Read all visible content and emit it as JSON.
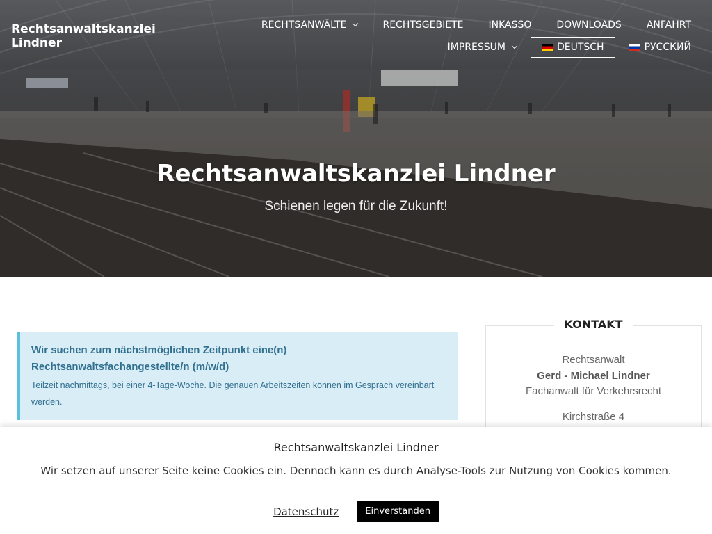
{
  "site": {
    "title": "Rechtsanwaltskanzlei Lindner"
  },
  "nav": {
    "items": [
      {
        "label": "Rechtsanwälte",
        "has_dropdown": true
      },
      {
        "label": "Rechtsgebiete"
      },
      {
        "label": "Inkasso"
      },
      {
        "label": "Downloads"
      },
      {
        "label": "Anfahrt"
      },
      {
        "label": "Impressum",
        "has_dropdown": true
      },
      {
        "label": "Deutsch",
        "flag": "flag-germany-icon",
        "active": true
      },
      {
        "label": "Русский",
        "flag": "flag-russia-icon"
      }
    ]
  },
  "hero": {
    "title": "Rechtsanwaltskanzlei Lindner",
    "subtitle": "Schienen legen für die Zukunft!"
  },
  "notice": {
    "title": "Wir suchen zum nächstmöglichen Zeitpunkt eine(n) Rechtsanwaltsfachangestellte/n (m/w/d)",
    "text": "Teilzeit nachmittags, bei einer 4-Tage-Woche. Die genauen Arbeitszeiten können im Gespräch vereinbart werden."
  },
  "sidebar": {
    "title": "KONTAKT",
    "role": "Rechtsanwalt",
    "name": "Gerd - Michael Lindner",
    "specialty": "Fachanwalt für Verkehrsrecht",
    "street": "Kirchstraße 4"
  },
  "cookie": {
    "title": "Rechtsanwaltskanzlei Lindner",
    "text": "Wir setzen auf unserer Seite keine Cookies ein. Dennoch kann es durch Analyse-Tools zur Nutzung von Cookies kommen.",
    "privacy_label": "Datenschutz",
    "accept_label": "Einverstanden"
  },
  "colors": {
    "notice_bg": "#d9edf7",
    "notice_border": "#5bc0de",
    "notice_text": "#31708f",
    "accept_bg": "#000000"
  }
}
